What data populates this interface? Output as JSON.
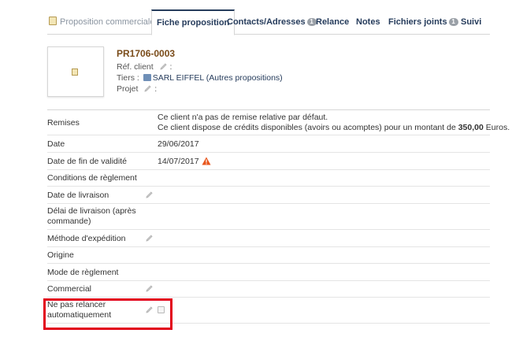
{
  "tabs": [
    {
      "label": "Proposition commerciale",
      "state": "inactive",
      "icon": "document-icon"
    },
    {
      "label": "Fiche proposition",
      "state": "active"
    },
    {
      "label": "Contacts/Adresses",
      "badge": "1"
    },
    {
      "label": "Relance"
    },
    {
      "label": "Notes"
    },
    {
      "label": "Fichiers joints",
      "badge": "1"
    },
    {
      "label": "Suivi"
    }
  ],
  "header": {
    "ref": "PR1706-0003",
    "ref_client_label": "Réf. client",
    "ref_client_suffix": ":",
    "tiers_label": "Tiers :",
    "tiers_value": "SARL EIFFEL",
    "tiers_suffix": "(Autres propositions)",
    "projet_label": "Projet",
    "projet_suffix": ":"
  },
  "fields": {
    "remises_label": "Remises",
    "remises_line1": "Ce client n'a pas de remise relative par défaut.",
    "remises_line2_pre": "Ce client dispose de crédits disponibles (avoirs ou acomptes) pour un montant de ",
    "remises_amount": "350,00",
    "remises_line2_post": " Euros.",
    "date_label": "Date",
    "date_value": "29/06/2017",
    "fin_validite_label": "Date de fin de validité",
    "fin_validite_value": "14/07/2017",
    "conditions_label": "Conditions de règlement",
    "livraison_label": "Date de livraison",
    "delai_label_1": "Délai de livraison (après",
    "delai_label_2": "commande)",
    "expedition_label": "Méthode d'expédition",
    "origine_label": "Origine",
    "mode_reglement_label": "Mode de règlement",
    "commercial_label": "Commercial",
    "relance_label_1": "Ne pas relancer",
    "relance_label_2": "automatiquement"
  },
  "colors": {
    "accent": "#263c5c",
    "ref": "#7a4c1a",
    "highlight": "#e2001a",
    "warning": "#e8551c"
  }
}
